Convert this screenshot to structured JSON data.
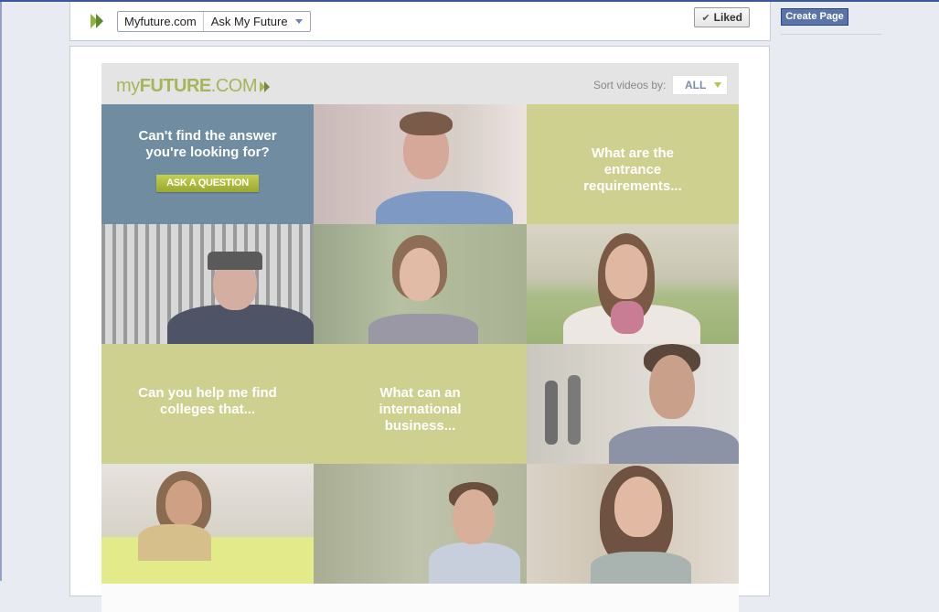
{
  "header": {
    "page_name": "Myfuture.com",
    "app_name": "Ask My Future",
    "liked_label": "Liked",
    "check_glyph": "✔",
    "fav_icon": "green-double-chevron-icon"
  },
  "right_column": {
    "create_page_label": "Create Page"
  },
  "app": {
    "logo": {
      "part1": "my",
      "part2": "FUTURE",
      "part3": ".COM"
    },
    "sort_label": "Sort videos by:",
    "sort_value": "ALL",
    "tiles": [
      {
        "type": "question",
        "line1": "Can't find the answer",
        "line2": "you're looking for?",
        "button": "ASK A QUESTION"
      },
      {
        "type": "video",
        "desc": "young man in blue shirt"
      },
      {
        "type": "prompt",
        "line1": "What are the",
        "line2": "entrance",
        "line3": "requirements..."
      },
      {
        "type": "video",
        "desc": "marine in uniform"
      },
      {
        "type": "video",
        "desc": "young woman outdoors"
      },
      {
        "type": "video",
        "desc": "woman with pink scarf"
      },
      {
        "type": "prompt",
        "line1": "Can you help me find",
        "line2": "colleges that..."
      },
      {
        "type": "prompt",
        "line1": "What can an",
        "line2": "international",
        "line3": "business..."
      },
      {
        "type": "video",
        "desc": "young man with glasses"
      },
      {
        "type": "video",
        "desc": "woman drawing"
      },
      {
        "type": "video",
        "desc": "young man with backpack"
      },
      {
        "type": "video",
        "desc": "young woman with scarf"
      }
    ]
  },
  "colors": {
    "fb_blue": "#3b5998",
    "tile_blue": "#6f8ca0",
    "tile_green": "#cdd08f",
    "accent_green": "#a6b45a"
  }
}
